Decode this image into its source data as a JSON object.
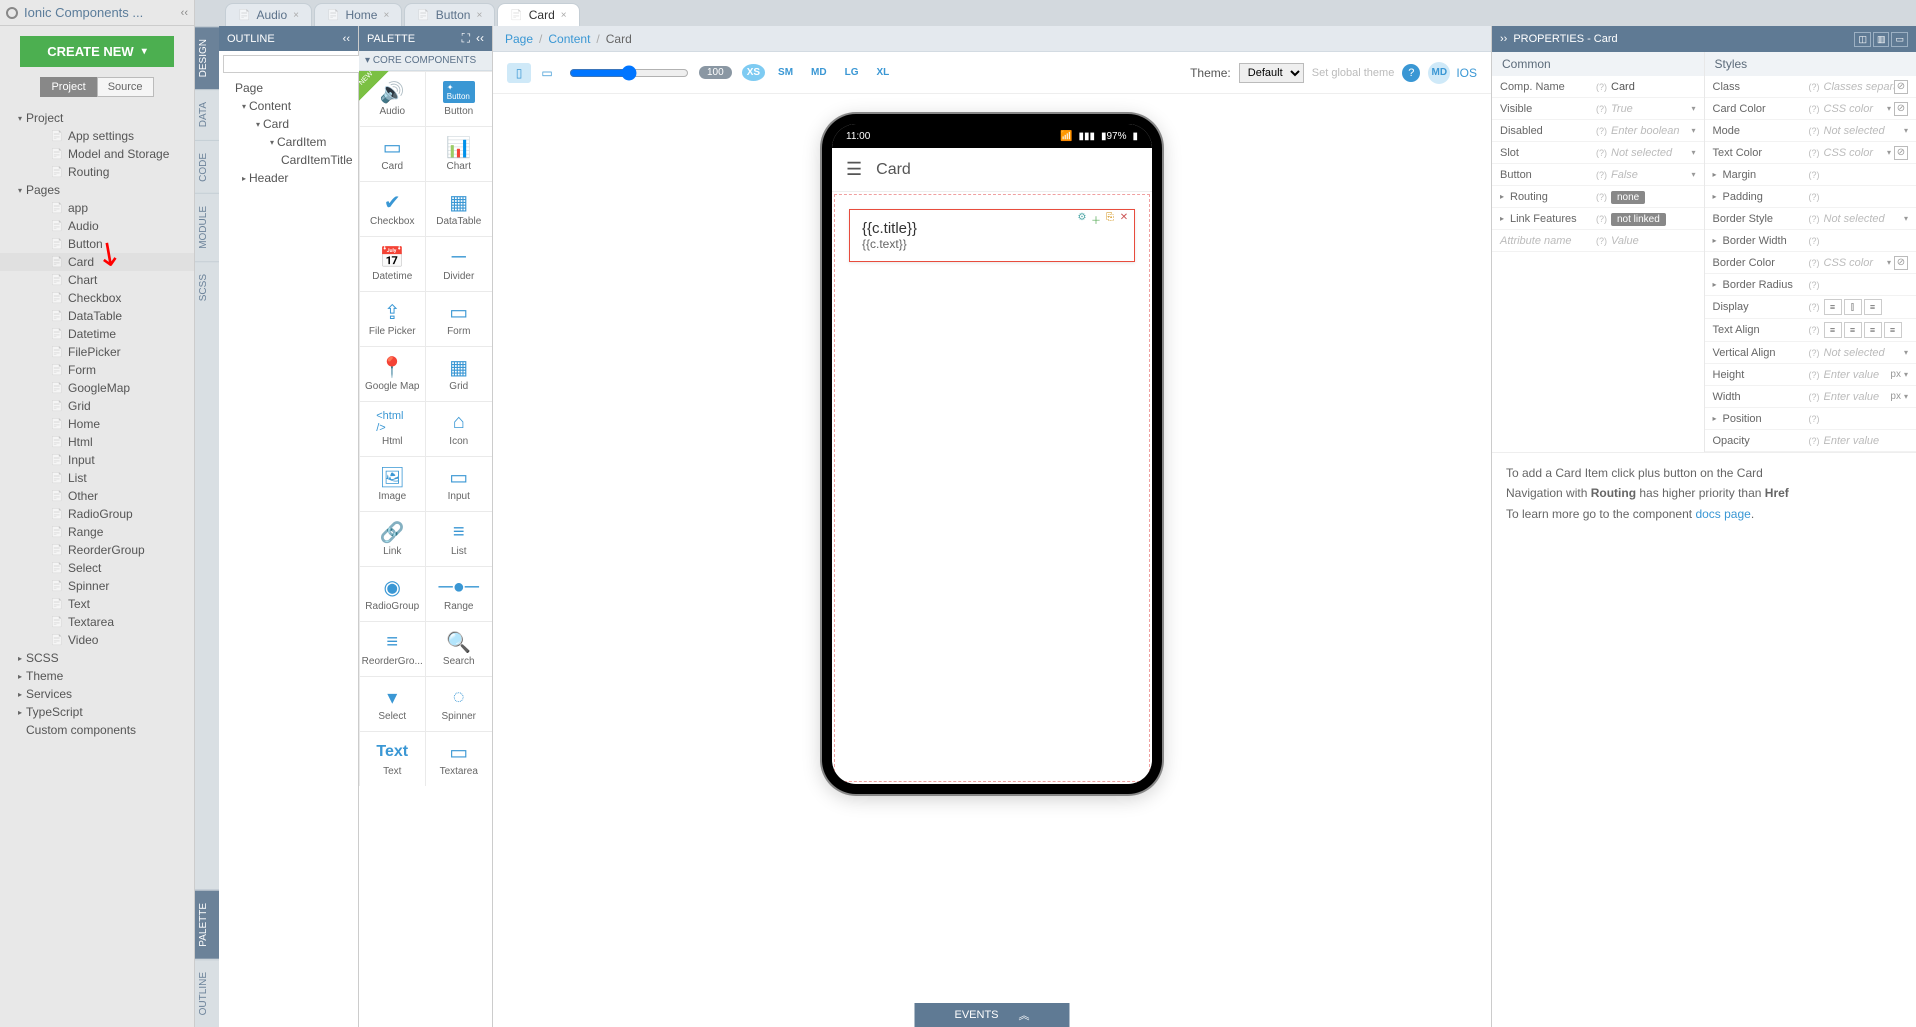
{
  "header": {
    "title": "Ionic Components ..."
  },
  "createButton": "CREATE NEW",
  "viewToggle": {
    "project": "Project",
    "source": "Source"
  },
  "projectTree": [
    {
      "label": "Project",
      "level": 1,
      "expandable": true,
      "expanded": true
    },
    {
      "label": "App settings",
      "level": 2
    },
    {
      "label": "Model and Storage",
      "level": 2
    },
    {
      "label": "Routing",
      "level": 2
    },
    {
      "label": "Pages",
      "level": 1,
      "expandable": true,
      "expanded": true
    },
    {
      "label": "app",
      "level": 2
    },
    {
      "label": "Audio",
      "level": 2
    },
    {
      "label": "Button",
      "level": 2
    },
    {
      "label": "Card",
      "level": 2,
      "active": true
    },
    {
      "label": "Chart",
      "level": 2
    },
    {
      "label": "Checkbox",
      "level": 2
    },
    {
      "label": "DataTable",
      "level": 2
    },
    {
      "label": "Datetime",
      "level": 2
    },
    {
      "label": "FilePicker",
      "level": 2
    },
    {
      "label": "Form",
      "level": 2
    },
    {
      "label": "GoogleMap",
      "level": 2
    },
    {
      "label": "Grid",
      "level": 2
    },
    {
      "label": "Home",
      "level": 2
    },
    {
      "label": "Html",
      "level": 2
    },
    {
      "label": "Input",
      "level": 2
    },
    {
      "label": "List",
      "level": 2
    },
    {
      "label": "Other",
      "level": 2
    },
    {
      "label": "RadioGroup",
      "level": 2
    },
    {
      "label": "Range",
      "level": 2
    },
    {
      "label": "ReorderGroup",
      "level": 2
    },
    {
      "label": "Select",
      "level": 2
    },
    {
      "label": "Spinner",
      "level": 2
    },
    {
      "label": "Text",
      "level": 2
    },
    {
      "label": "Textarea",
      "level": 2
    },
    {
      "label": "Video",
      "level": 2
    },
    {
      "label": "SCSS",
      "level": 1,
      "expandable": true
    },
    {
      "label": "Theme",
      "level": 1,
      "expandable": true
    },
    {
      "label": "Services",
      "level": 1,
      "expandable": true
    },
    {
      "label": "TypeScript",
      "level": 1,
      "expandable": true
    },
    {
      "label": "Custom components",
      "level": 1
    }
  ],
  "sideTabs": [
    "DESIGN",
    "DATA",
    "CODE",
    "MODULE",
    "SCSS"
  ],
  "sideTabsBottom": [
    "PALETTE",
    "OUTLINE"
  ],
  "tabs": [
    {
      "label": "Audio",
      "active": false
    },
    {
      "label": "Home",
      "active": false
    },
    {
      "label": "Button",
      "active": false
    },
    {
      "label": "Card",
      "active": true
    }
  ],
  "outline": {
    "title": "OUTLINE",
    "searchPlaceholder": "",
    "nodes": [
      {
        "label": "Page",
        "level": 0
      },
      {
        "label": "Content",
        "level": 1,
        "exp": "▾"
      },
      {
        "label": "Card",
        "level": 2,
        "exp": "▾"
      },
      {
        "label": "CardItem",
        "level": 3,
        "exp": "▾"
      },
      {
        "label": "CardItemTitle",
        "level": 4
      },
      {
        "label": "Header",
        "level": 1,
        "exp": "▸"
      }
    ]
  },
  "palette": {
    "title": "PALETTE",
    "section": "CORE COMPONENTS",
    "items": [
      {
        "label": "Audio",
        "icon": "🔊",
        "new": true
      },
      {
        "label": "Button",
        "icon": "btn"
      },
      {
        "label": "Card",
        "icon": "▭"
      },
      {
        "label": "Chart",
        "icon": "📊"
      },
      {
        "label": "Checkbox",
        "icon": "✔"
      },
      {
        "label": "DataTable",
        "icon": "▦"
      },
      {
        "label": "Datetime",
        "icon": "📅"
      },
      {
        "label": "Divider",
        "icon": "─"
      },
      {
        "label": "File Picker",
        "icon": "⇪"
      },
      {
        "label": "Form",
        "icon": "▭"
      },
      {
        "label": "Google Map",
        "icon": "📍"
      },
      {
        "label": "Grid",
        "icon": "▦"
      },
      {
        "label": "Html",
        "icon": "<html />"
      },
      {
        "label": "Icon",
        "icon": "⌂"
      },
      {
        "label": "Image",
        "icon": "🖼"
      },
      {
        "label": "Input",
        "icon": "▭"
      },
      {
        "label": "Link",
        "icon": "🔗"
      },
      {
        "label": "List",
        "icon": "≡"
      },
      {
        "label": "RadioGroup",
        "icon": "◉"
      },
      {
        "label": "Range",
        "icon": "─●─"
      },
      {
        "label": "ReorderGro...",
        "icon": "≡"
      },
      {
        "label": "Search",
        "icon": "🔍"
      },
      {
        "label": "Select",
        "icon": "▾"
      },
      {
        "label": "Spinner",
        "icon": "◌"
      },
      {
        "label": "Text",
        "icon": "Text"
      },
      {
        "label": "Textarea",
        "icon": "▭"
      }
    ]
  },
  "breadcrumb": [
    "Page",
    "Content",
    "Card"
  ],
  "canvasToolbar": {
    "zoom": "100",
    "breakpoints": [
      "XS",
      "SM",
      "MD",
      "LG",
      "XL"
    ],
    "themeLabel": "Theme:",
    "themeValue": "Default",
    "globalTheme": "Set global theme",
    "platform": {
      "md": "MD",
      "ios": "IOS"
    }
  },
  "phone": {
    "time": "11:00",
    "battery": "97%",
    "headerTitle": "Card",
    "cardTitle": "{{c.title}}",
    "cardText": "{{c.text}}"
  },
  "eventsLabel": "EVENTS",
  "properties": {
    "title": "PROPERTIES - Card",
    "commonLabel": "Common",
    "stylesLabel": "Styles",
    "common": [
      {
        "label": "Comp. Name",
        "value": "Card",
        "type": "text"
      },
      {
        "label": "Visible",
        "placeholder": "True",
        "type": "dd"
      },
      {
        "label": "Disabled",
        "placeholder": "Enter boolean",
        "type": "dd"
      },
      {
        "label": "Slot",
        "placeholder": "Not selected",
        "type": "dd"
      },
      {
        "label": "Button",
        "placeholder": "False",
        "type": "dd"
      },
      {
        "label": "Routing",
        "badge": "none",
        "expandable": true
      },
      {
        "label": "Link Features",
        "badge": "not linked",
        "expandable": true
      },
      {
        "label": "",
        "placeholder_label": "Attribute name",
        "placeholder": "Value",
        "type": "text",
        "custom": true
      }
    ],
    "styles": [
      {
        "label": "Class",
        "placeholder": "Classes separated w",
        "type": "text",
        "clear": true
      },
      {
        "label": "Card Color",
        "placeholder": "CSS color",
        "type": "color"
      },
      {
        "label": "Mode",
        "placeholder": "Not selected",
        "type": "dd"
      },
      {
        "label": "Text Color",
        "placeholder": "CSS color",
        "type": "color"
      },
      {
        "label": "Margin",
        "expandable": true
      },
      {
        "label": "Padding",
        "expandable": true
      },
      {
        "label": "Border Style",
        "placeholder": "Not selected",
        "type": "dd"
      },
      {
        "label": "Border Width",
        "expandable": true
      },
      {
        "label": "Border Color",
        "placeholder": "CSS color",
        "type": "color"
      },
      {
        "label": "Border Radius",
        "expandable": true
      },
      {
        "label": "Display",
        "type": "align3"
      },
      {
        "label": "Text Align",
        "type": "align4"
      },
      {
        "label": "Vertical Align",
        "placeholder": "Not selected",
        "type": "dd"
      },
      {
        "label": "Height",
        "placeholder": "Enter value",
        "unit": "px",
        "type": "unit"
      },
      {
        "label": "Width",
        "placeholder": "Enter value",
        "unit": "px",
        "type": "unit"
      },
      {
        "label": "Position",
        "expandable": true
      },
      {
        "label": "Opacity",
        "placeholder": "Enter value",
        "type": "text"
      }
    ],
    "notes": {
      "line1a": "To add a Card Item click plus button on the Card",
      "line2a": "Navigation with ",
      "line2b": "Routing",
      "line2c": " has higher priority than ",
      "line2d": "Href",
      "line3a": "To learn more go to the component ",
      "line3b": "docs page",
      "line3c": "."
    }
  }
}
